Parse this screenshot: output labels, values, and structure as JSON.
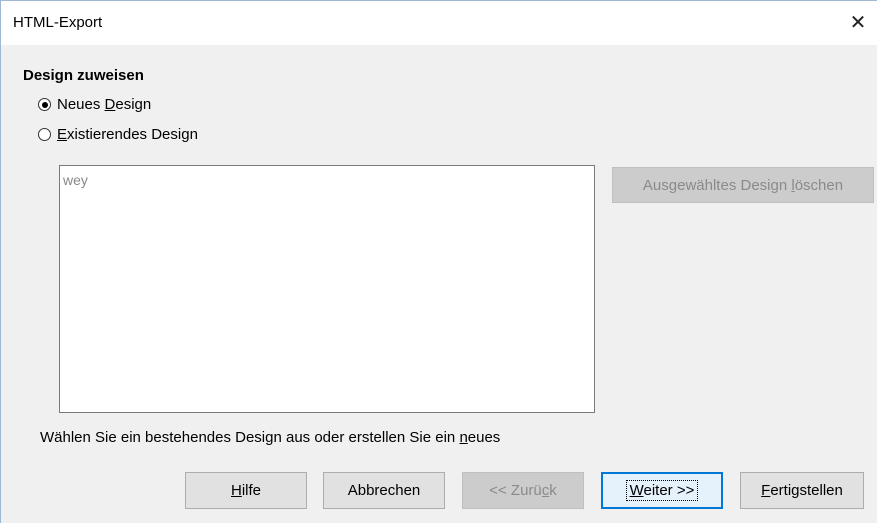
{
  "window": {
    "title": "HTML-Export"
  },
  "section": {
    "title": "Design zuweisen"
  },
  "options": {
    "new_design": {
      "pre": "Neues ",
      "accel": "D",
      "post": "esign",
      "checked": true
    },
    "existing_design": {
      "pre": "",
      "accel": "E",
      "post": "xistierendes Design",
      "checked": false
    }
  },
  "design_list": {
    "items": [
      "wey"
    ]
  },
  "delete_button": {
    "pre": "Ausgewähltes Design ",
    "accel": "l",
    "post": "öschen",
    "disabled": true
  },
  "hint": {
    "pre": "Wählen Sie ein bestehendes Design aus oder erstellen Sie ein ",
    "accel": "n",
    "post": "eues"
  },
  "footer": {
    "help": {
      "pre": "",
      "accel": "H",
      "post": "ilfe"
    },
    "cancel": {
      "label": "Abbrechen"
    },
    "back": {
      "pre": "<< Zurü",
      "accel": "c",
      "post": "k",
      "disabled": true
    },
    "next": {
      "pre": "",
      "accel": "W",
      "post": "eiter >>"
    },
    "finish": {
      "pre": "",
      "accel": "F",
      "post": "ertigstellen"
    }
  },
  "colors": {
    "accent": "#0078d7",
    "disabled_text": "#8a8a8a",
    "list_item_text": "#888888"
  }
}
